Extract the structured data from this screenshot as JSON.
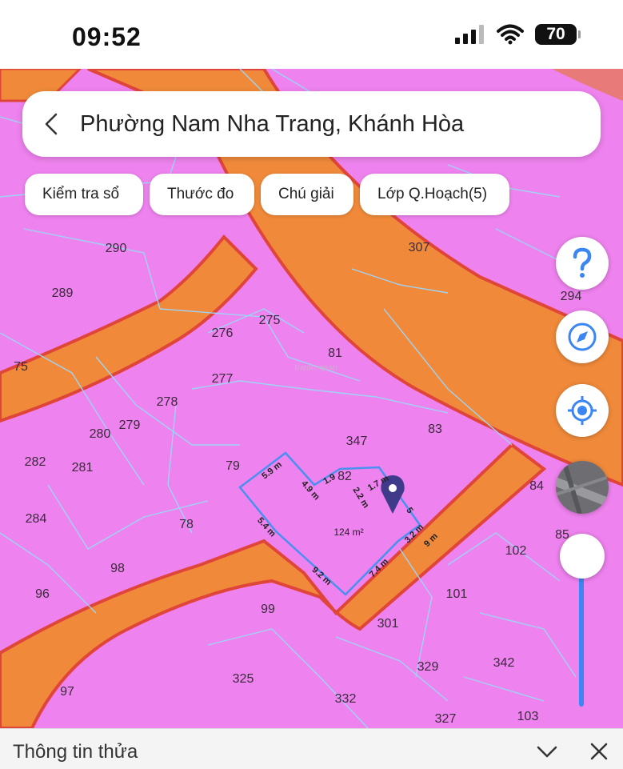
{
  "status_bar": {
    "time": "09:52",
    "battery": "70"
  },
  "search": {
    "title": "Phường Nam Nha Trang, Khánh Hòa"
  },
  "chips": [
    {
      "label": "Kiểm tra sổ"
    },
    {
      "label": "Thước đo"
    },
    {
      "label": "Chú giải"
    },
    {
      "label": "Lớp Q.Hoạch(5)"
    }
  ],
  "map": {
    "land_color": "#ee82ee",
    "road_color": "#f08a3a",
    "parcel_line_color": "#9fd3f5",
    "measure_color": "#4a90f0",
    "watermark": "Batdongsan",
    "parcels": [
      "290",
      "307",
      "289",
      "294",
      "276",
      "275",
      "75",
      "81",
      "277",
      "278",
      "279",
      "280",
      "347",
      "83",
      "282",
      "281",
      "79",
      "84",
      "284",
      "78",
      "85",
      "102",
      "98",
      "101",
      "96",
      "99",
      "301",
      "329",
      "342",
      "325",
      "97",
      "332",
      "327",
      "103",
      "82"
    ],
    "measurements": [
      "5.9 m",
      "4.9 m",
      "1.9",
      "1.7 m",
      "2.2 m",
      "5.4 m",
      "9.2 m",
      "7.4 m",
      "3.2 m",
      "9 m",
      "5"
    ],
    "area": "124 m²"
  },
  "sheet": {
    "title": "Thông tin thửa"
  }
}
